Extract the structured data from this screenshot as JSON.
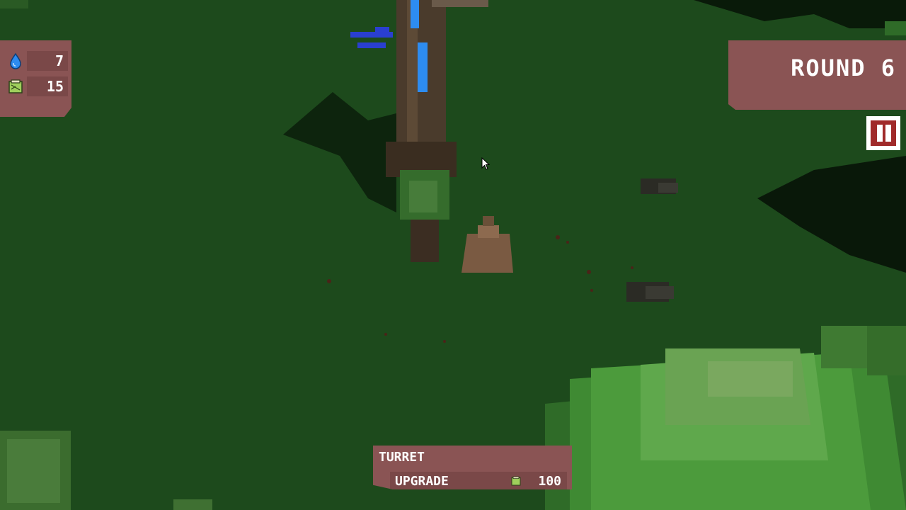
{
  "hud": {
    "water_icon": "water-drop-icon",
    "water_count": "7",
    "paper_icon": "paper-stack-icon",
    "paper_count": "15",
    "round_label": "ROUND 6",
    "pause_icon": "pause-icon"
  },
  "selection": {
    "title": "TURRET",
    "upgrade_label": "UPGRADE",
    "cost_icon": "paper-stack-icon",
    "upgrade_cost": "100"
  },
  "colors": {
    "panel": "#8a5454",
    "panel_dark": "#7a4848",
    "pause_red": "#a02a2a",
    "ground": "#1c4a1c",
    "water_blue": "#2d8cf0"
  }
}
